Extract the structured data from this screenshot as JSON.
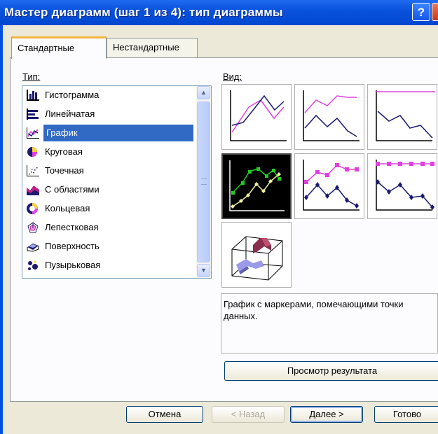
{
  "window": {
    "title": "Мастер диаграмм (шаг 1 из 4): тип диаграммы",
    "help_label": "?"
  },
  "tabs": [
    {
      "label": "Стандартные",
      "active": true
    },
    {
      "label": "Нестандартные",
      "active": false
    }
  ],
  "type_list": {
    "label": "Тип:",
    "items": [
      {
        "label": "Гистограмма",
        "icon": "column-chart-icon"
      },
      {
        "label": "Линейчатая",
        "icon": "bar-chart-icon"
      },
      {
        "label": "График",
        "icon": "line-chart-icon",
        "selected": true
      },
      {
        "label": "Круговая",
        "icon": "pie-chart-icon"
      },
      {
        "label": "Точечная",
        "icon": "scatter-chart-icon"
      },
      {
        "label": "С областями",
        "icon": "area-chart-icon"
      },
      {
        "label": "Кольцевая",
        "icon": "doughnut-chart-icon"
      },
      {
        "label": "Лепестковая",
        "icon": "radar-chart-icon"
      },
      {
        "label": "Поверхность",
        "icon": "surface-chart-icon"
      },
      {
        "label": "Пузырьковая",
        "icon": "bubble-chart-icon"
      }
    ]
  },
  "subtype": {
    "label": "Вид:",
    "description": "График с маркерами, помечающими точки данных.",
    "preview_button": "Просмотр результата"
  },
  "buttons": {
    "cancel": "Отмена",
    "back": "< Назад",
    "next": "Далее >",
    "finish": "Готово"
  },
  "colors": {
    "titlebar": "#0a52dc",
    "dialog_bg": "#ece9d8",
    "selection": "#316ac5",
    "series_magenta": "#e040e0",
    "series_navy": "#1a1a6e",
    "selected_tile_green": "#22cc22",
    "selected_tile_yellow": "#f0f0a0"
  }
}
